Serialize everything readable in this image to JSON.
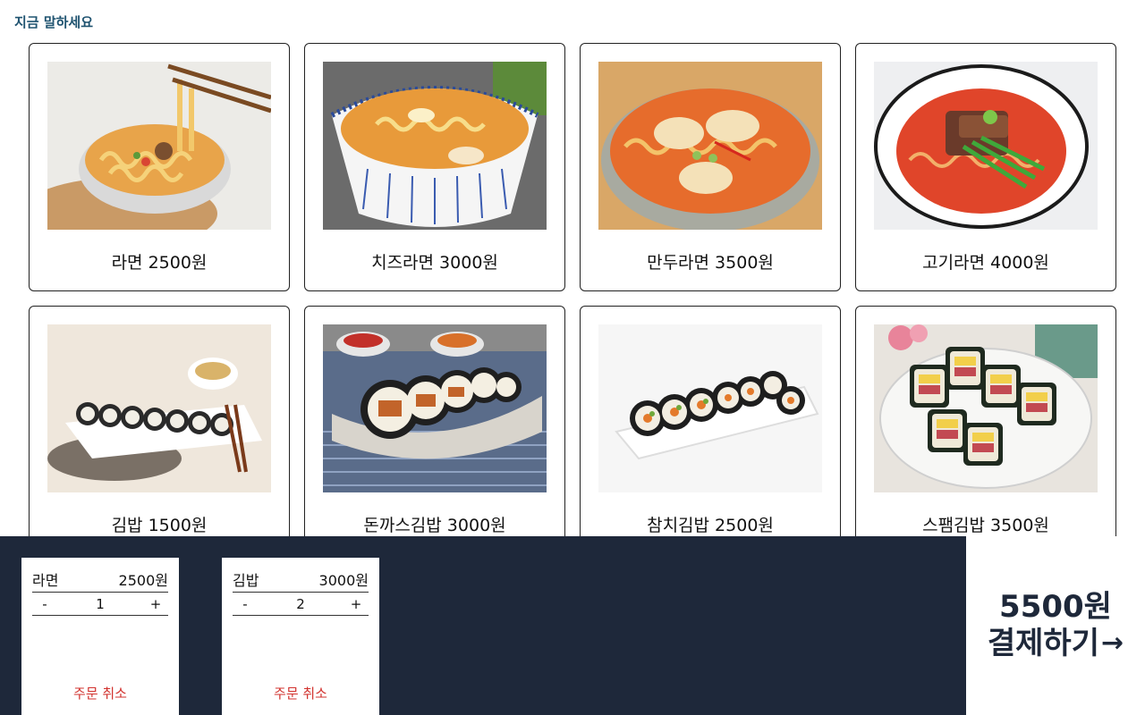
{
  "header": {
    "voice_prompt": "지금 말하세요"
  },
  "menu": [
    {
      "label": "라면 2500원",
      "icon": "ramen-image"
    },
    {
      "label": "치즈라면 3000원",
      "icon": "cheese-ramen-image"
    },
    {
      "label": "만두라면 3500원",
      "icon": "dumpling-ramen-image"
    },
    {
      "label": "고기라면 4000원",
      "icon": "meat-ramen-image"
    },
    {
      "label": "김밥 1500원",
      "icon": "kimbap-image"
    },
    {
      "label": "돈까스김밥 3000원",
      "icon": "pork-cutlet-kimbap-image"
    },
    {
      "label": "참치김밥 2500원",
      "icon": "tuna-kimbap-image"
    },
    {
      "label": "스팸김밥 3500원",
      "icon": "spam-kimbap-image"
    }
  ],
  "order": [
    {
      "name": "라면",
      "price": "2500원",
      "minus": "-",
      "qty": "1",
      "plus": "+",
      "cancel": "주문 취소"
    },
    {
      "name": "김밥",
      "price": "3000원",
      "minus": "-",
      "qty": "2",
      "plus": "+",
      "cancel": "주문 취소"
    }
  ],
  "checkout": {
    "total": "5500원",
    "pay_label": "결제하기",
    "arrow": "→"
  },
  "colors": {
    "panel": "#1e283a",
    "prompt": "#1f5370",
    "cancel": "#d2332f"
  }
}
